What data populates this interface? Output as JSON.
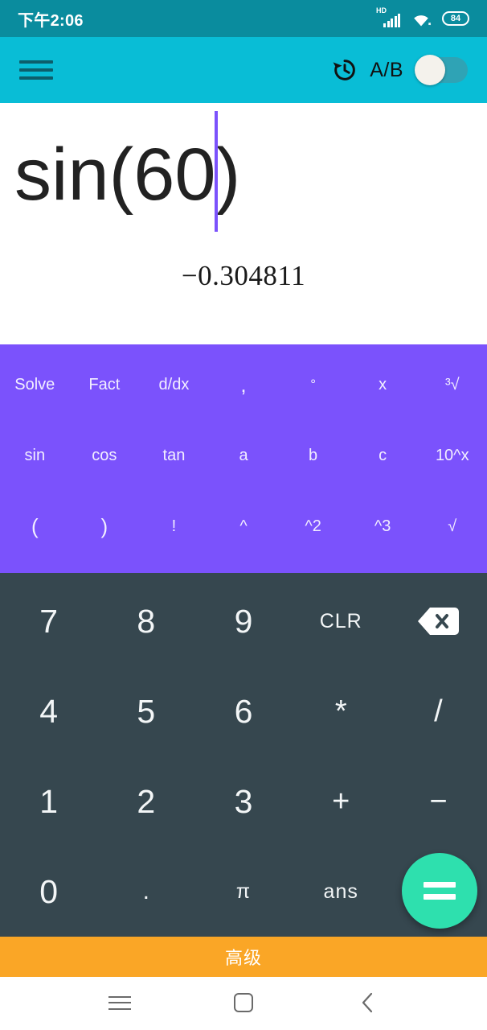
{
  "status_bar": {
    "time": "下午2:06",
    "network_label": "HD",
    "battery_level": "84",
    "icons": [
      "hd-signal-icon",
      "wifi-icon",
      "battery-icon"
    ]
  },
  "app_bar": {
    "menu_icon": "hamburger-menu-icon",
    "history_icon": "history-restore-icon",
    "ab_toggle_label": "A/B",
    "ab_toggle_state": "off"
  },
  "display": {
    "expression_before_caret": "sin(60",
    "expression_after_caret": ")",
    "result": "−0.304811"
  },
  "function_pad": {
    "rows": [
      [
        {
          "label": "Solve",
          "name": "fn-key-solve",
          "size": "small"
        },
        {
          "label": "Fact",
          "name": "fn-key-fact",
          "size": "small"
        },
        {
          "label": "d/dx",
          "name": "fn-key-ddx",
          "size": "small"
        },
        {
          "label": ",",
          "name": "fn-key-comma",
          "size": "normal"
        },
        {
          "label": "°",
          "name": "fn-key-degree",
          "size": "tiny"
        },
        {
          "label": "x",
          "name": "fn-key-x",
          "size": "small"
        },
        {
          "label": "³√",
          "name": "fn-key-cube-root",
          "size": "small"
        }
      ],
      [
        {
          "label": "sin",
          "name": "fn-key-sin",
          "size": "small"
        },
        {
          "label": "cos",
          "name": "fn-key-cos",
          "size": "small"
        },
        {
          "label": "tan",
          "name": "fn-key-tan",
          "size": "small"
        },
        {
          "label": "a",
          "name": "fn-key-a",
          "size": "small"
        },
        {
          "label": "b",
          "name": "fn-key-b",
          "size": "small"
        },
        {
          "label": "c",
          "name": "fn-key-c",
          "size": "small"
        },
        {
          "label": "10^x",
          "name": "fn-key-ten-power-x",
          "size": "small"
        }
      ],
      [
        {
          "label": "(",
          "name": "fn-key-open-paren",
          "size": "normal"
        },
        {
          "label": ")",
          "name": "fn-key-close-paren",
          "size": "normal"
        },
        {
          "label": "!",
          "name": "fn-key-factorial",
          "size": "small"
        },
        {
          "label": "^",
          "name": "fn-key-power",
          "size": "small"
        },
        {
          "label": "^2",
          "name": "fn-key-square",
          "size": "small"
        },
        {
          "label": "^3",
          "name": "fn-key-cube",
          "size": "small"
        },
        {
          "label": "√",
          "name": "fn-key-sqrt",
          "size": "small"
        }
      ]
    ]
  },
  "numeric_pad": {
    "rows": [
      [
        {
          "label": "7",
          "name": "num-key-7",
          "kind": "digit"
        },
        {
          "label": "8",
          "name": "num-key-8",
          "kind": "digit"
        },
        {
          "label": "9",
          "name": "num-key-9",
          "kind": "digit"
        },
        {
          "label": "CLR",
          "name": "num-key-clear",
          "kind": "lbl"
        },
        {
          "label": "",
          "name": "backspace-icon",
          "kind": "backspace"
        }
      ],
      [
        {
          "label": "4",
          "name": "num-key-4",
          "kind": "digit"
        },
        {
          "label": "5",
          "name": "num-key-5",
          "kind": "digit"
        },
        {
          "label": "6",
          "name": "num-key-6",
          "kind": "digit"
        },
        {
          "label": "*",
          "name": "num-key-multiply",
          "kind": "op"
        },
        {
          "label": "/",
          "name": "num-key-divide",
          "kind": "op"
        }
      ],
      [
        {
          "label": "1",
          "name": "num-key-1",
          "kind": "digit"
        },
        {
          "label": "2",
          "name": "num-key-2",
          "kind": "digit"
        },
        {
          "label": "3",
          "name": "num-key-3",
          "kind": "digit"
        },
        {
          "label": "+",
          "name": "num-key-plus",
          "kind": "op"
        },
        {
          "label": "−",
          "name": "num-key-minus",
          "kind": "op"
        }
      ],
      [
        {
          "label": "0",
          "name": "num-key-0",
          "kind": "digit"
        },
        {
          "label": ".",
          "name": "num-key-decimal",
          "kind": "dot"
        },
        {
          "label": "π",
          "name": "num-key-pi",
          "kind": "lbl"
        },
        {
          "label": "ans",
          "name": "num-key-ans",
          "kind": "lbl"
        },
        {
          "label": "",
          "name": "num-key-spacer",
          "kind": "spacer"
        }
      ]
    ],
    "equals_label": "="
  },
  "advanced_bar": {
    "label": "高级"
  },
  "nav_bar": {
    "items": [
      "nav-menu-icon",
      "nav-home-icon",
      "nav-back-icon"
    ]
  },
  "colors": {
    "status_bar": "#0A8C9E",
    "app_bar": "#09BDD6",
    "function_pad": "#7B52FC",
    "numeric_pad": "#36474F",
    "equals_fab": "#2EE0AE",
    "advanced_bar": "#FAA626",
    "caret": "#7B52FC"
  }
}
